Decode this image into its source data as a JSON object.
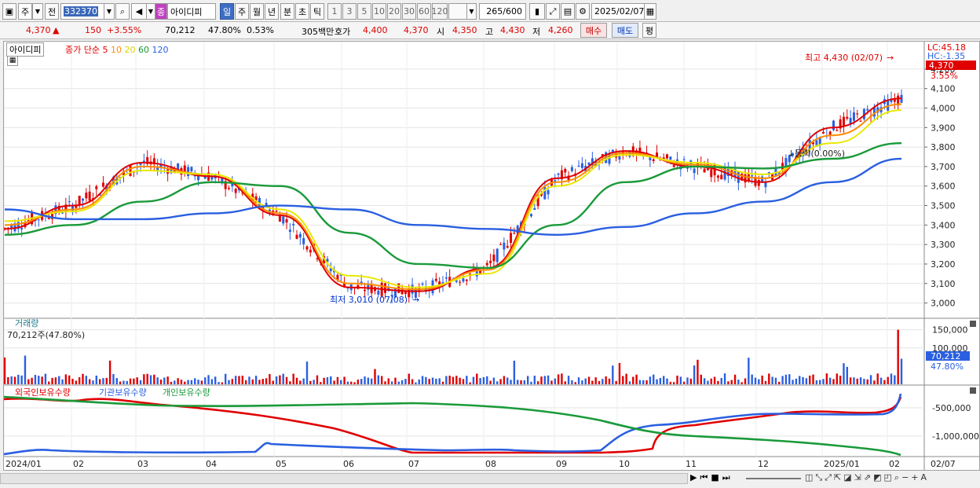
{
  "toolbar": {
    "period_label": "주",
    "prev_label": "전",
    "code_value": "332370",
    "name_badge": "종",
    "stock_name": "아이디피",
    "tabs": [
      "일",
      "주",
      "월",
      "년",
      "분",
      "초",
      "틱"
    ],
    "active_tab": "일",
    "intervals": [
      "1",
      "3",
      "5",
      "10",
      "20",
      "30",
      "60",
      "120"
    ],
    "count_display": "265",
    "count_total": "/600",
    "date_value": "2025/02/07"
  },
  "quote": {
    "price": "4,370",
    "change": "150",
    "change_pct": "+3.55%",
    "volume": "70,212",
    "vol_ratio": "47.80%",
    "turnover": "0.53%",
    "amount": "305백만",
    "ask_label": "호가",
    "ask1": "4,400",
    "ask2": "4,370",
    "open_label": "시",
    "open": "4,350",
    "high_label": "고",
    "high": "4,430",
    "low_label": "저",
    "low": "4,260",
    "buy_label": "매수",
    "sell_label": "매도",
    "eval_label": "평"
  },
  "price_panel": {
    "legend_name": "아이디피",
    "legend_ma": "종가 단순",
    "ma_periods": [
      "5",
      "10",
      "20",
      "60",
      "120"
    ],
    "ma_colors": [
      "#e00000",
      "#ff8c00",
      "#e8e800",
      "#1a9a3a",
      "#2a5fe0"
    ],
    "lc_label": "LC:45.18",
    "hc_label": "HC:-1.35",
    "price_tag": "4,370",
    "pct_tag": "3.55%",
    "high_note": "최고 4,430 (02/07)",
    "low_note": "최저 3,010 (07/08)",
    "mid_note": "↓등락(0.00%)",
    "y_ticks": [
      "4,200",
      "4,100",
      "4,000",
      "3,900",
      "3,800",
      "3,700",
      "3,600",
      "3,500",
      "3,400",
      "3,300",
      "3,200",
      "3,100",
      "3,000"
    ]
  },
  "volume_panel": {
    "title": "거래량",
    "summary": "70,212주(47.80%)",
    "y_ticks": [
      "150,000",
      "100,000"
    ],
    "tag_value": "70,212",
    "tag_pct": "47.80%"
  },
  "holding_panel": {
    "legends": [
      "외국인보유수량",
      "기관보유수량",
      "개인보유수량"
    ],
    "legend_colors": [
      "#e00000",
      "#2a5fe0",
      "#1a9a3a"
    ],
    "y_ticks": [
      "-500,000",
      "-1,000,000"
    ]
  },
  "x_axis": {
    "labels": [
      "2024/01",
      "02",
      "03",
      "04",
      "05",
      "06",
      "07",
      "08",
      "09",
      "10",
      "11",
      "12",
      "2025/01",
      "02",
      "02/07"
    ]
  },
  "chart_data": {
    "type": "line",
    "x": [
      "2024/01",
      "02",
      "03",
      "04",
      "05",
      "06",
      "07",
      "08",
      "09",
      "10",
      "11",
      "12",
      "2025/01",
      "02"
    ],
    "series": [
      {
        "name": "5",
        "values": [
          3380,
          3500,
          3720,
          3650,
          3450,
          3080,
          3060,
          3180,
          3640,
          3780,
          3700,
          3620,
          3900,
          4050
        ]
      },
      {
        "name": "10",
        "values": [
          3400,
          3480,
          3700,
          3660,
          3460,
          3100,
          3070,
          3170,
          3620,
          3770,
          3710,
          3640,
          3860,
          4020
        ]
      },
      {
        "name": "20",
        "values": [
          3420,
          3470,
          3680,
          3660,
          3480,
          3140,
          3080,
          3150,
          3600,
          3760,
          3720,
          3660,
          3820,
          3990
        ]
      },
      {
        "name": "60",
        "values": [
          3350,
          3400,
          3520,
          3620,
          3600,
          3360,
          3200,
          3180,
          3400,
          3620,
          3700,
          3690,
          3740,
          3820
        ]
      },
      {
        "name": "120",
        "values": [
          3480,
          3430,
          3430,
          3460,
          3500,
          3480,
          3400,
          3380,
          3350,
          3390,
          3460,
          3520,
          3620,
          3740
        ]
      }
    ],
    "ylim": [
      2950,
      4500
    ],
    "high": 4430,
    "low": 3010
  }
}
